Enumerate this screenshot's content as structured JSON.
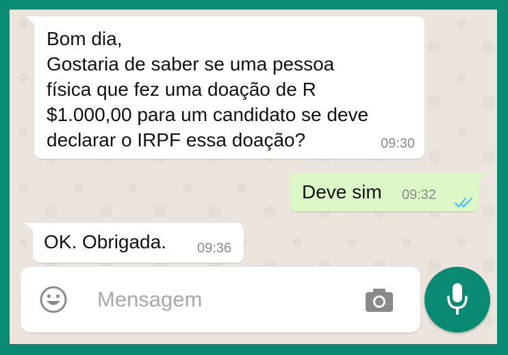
{
  "conversation": {
    "messages": [
      {
        "direction": "incoming",
        "text": "Bom dia,\nGostaria de saber se uma pessoa\nfísica que fez uma doação de R\n$1.000,00 para um candidato se deve\ndeclarar o IRPF essa doação?",
        "time": "09:30"
      },
      {
        "direction": "outgoing",
        "text": "Deve sim",
        "time": "09:32",
        "status_icon": "double-check-read-icon"
      },
      {
        "direction": "incoming",
        "text": "OK. Obrigada.",
        "time": "09:36"
      }
    ]
  },
  "composer": {
    "placeholder": "Mensagem",
    "emoji_icon": "emoji-icon",
    "camera_icon": "camera-icon",
    "mic_icon": "microphone-icon"
  },
  "colors": {
    "frame": "#0b8a73",
    "background": "#ece5dd",
    "incoming_bubble": "#ffffff",
    "outgoing_bubble": "#dcf8c6",
    "read_ticks": "#4fc3f7",
    "mic_button": "#0b8a73"
  }
}
